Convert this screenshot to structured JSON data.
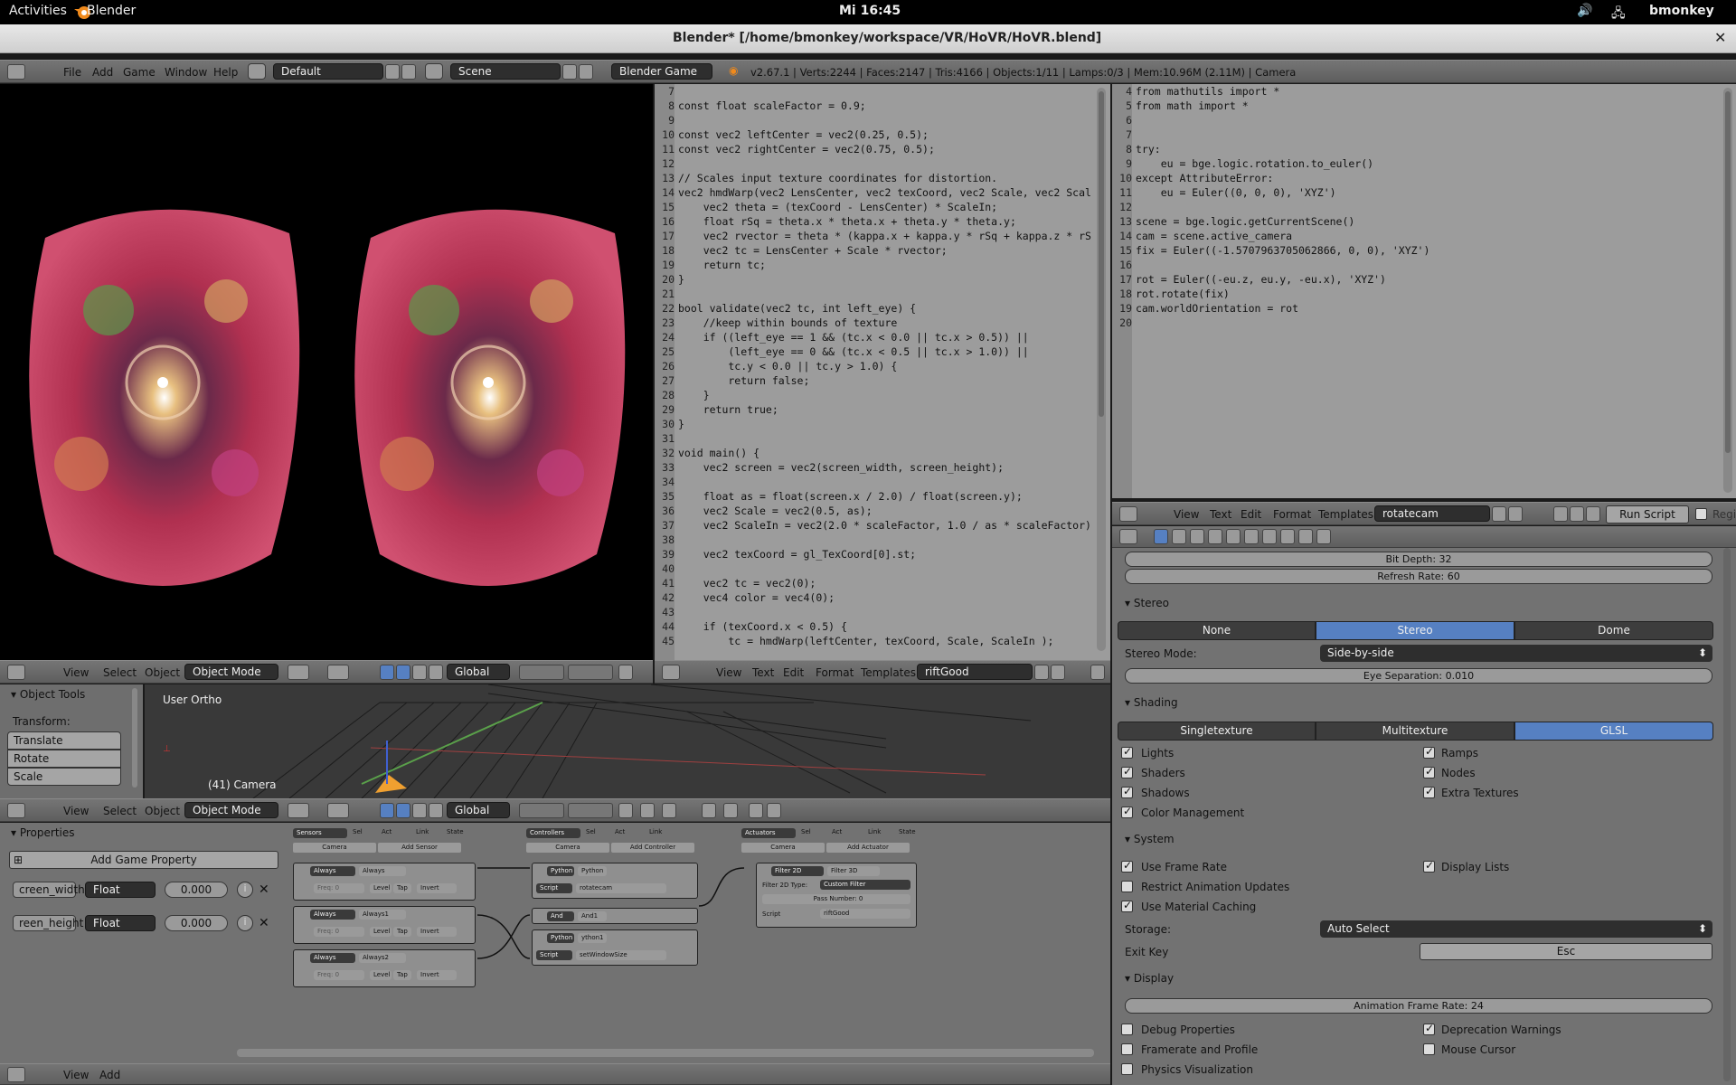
{
  "topbar": {
    "activities": "Activities",
    "app": "Blender",
    "clock": "Mi 16:45",
    "user": "bmonkey"
  },
  "window": {
    "title": "Blender* [/home/bmonkey/workspace/VR/HoVR/HoVR.blend]"
  },
  "info_header": {
    "menus": [
      "File",
      "Add",
      "Game",
      "Window",
      "Help"
    ],
    "layout": "Default",
    "scene": "Scene",
    "engine": "Blender Game",
    "stats": "v2.67.1 | Verts:2244 | Faces:2147 | Tris:4166 | Objects:1/11 | Lamps:0/3 | Mem:10.96M (2.11M) | Camera"
  },
  "glsl_editor": {
    "line_numbers": [
      "7",
      "8",
      "9",
      "10",
      "11",
      "12",
      "13",
      "14",
      "15",
      "16",
      "17",
      "18",
      "19",
      "20",
      "21",
      "22",
      "23",
      "24",
      "25",
      "26",
      "27",
      "28",
      "29",
      "30",
      "31",
      "32",
      "33",
      "34",
      "35",
      "36",
      "37",
      "38",
      "39",
      "40",
      "41",
      "42",
      "43",
      "44",
      "45"
    ],
    "lines": [
      "",
      "const float scaleFactor = 0.9;",
      "",
      "const vec2 leftCenter = vec2(0.25, 0.5);",
      "const vec2 rightCenter = vec2(0.75, 0.5);",
      "",
      "// Scales input texture coordinates for distortion.",
      "vec2 hmdWarp(vec2 LensCenter, vec2 texCoord, vec2 Scale, vec2 Scal",
      "    vec2 theta = (texCoord - LensCenter) * ScaleIn;",
      "    float rSq = theta.x * theta.x + theta.y * theta.y;",
      "    vec2 rvector = theta * (kappa.x + kappa.y * rSq + kappa.z * rS",
      "    vec2 tc = LensCenter + Scale * rvector;",
      "    return tc;",
      "}",
      "",
      "bool validate(vec2 tc, int left_eye) {",
      "    //keep within bounds of texture",
      "    if ((left_eye == 1 && (tc.x < 0.0 || tc.x > 0.5)) ||",
      "        (left_eye == 0 && (tc.x < 0.5 || tc.x > 1.0)) ||",
      "        tc.y < 0.0 || tc.y > 1.0) {",
      "        return false;",
      "    }",
      "    return true;",
      "}",
      "",
      "void main() {",
      "    vec2 screen = vec2(screen_width, screen_height);",
      "",
      "    float as = float(screen.x / 2.0) / float(screen.y);",
      "    vec2 Scale = vec2(0.5, as);",
      "    vec2 ScaleIn = vec2(2.0 * scaleFactor, 1.0 / as * scaleFactor)",
      "",
      "    vec2 texCoord = gl_TexCoord[0].st;",
      "",
      "    vec2 tc = vec2(0);",
      "    vec4 color = vec4(0);",
      "",
      "    if (texCoord.x < 0.5) {",
      "        tc = hmdWarp(leftCenter, texCoord, Scale, ScaleIn );"
    ],
    "menus": [
      "View",
      "Text",
      "Edit",
      "Format",
      "Templates"
    ],
    "file": "riftGood"
  },
  "py_editor": {
    "line_numbers": [
      "4",
      "5",
      "6",
      "7",
      "8",
      "9",
      "10",
      "11",
      "12",
      "13",
      "14",
      "15",
      "16",
      "17",
      "18",
      "19",
      "20"
    ],
    "lines": [
      "from mathutils import *",
      "from math import *",
      "",
      "",
      "try:",
      "    eu = bge.logic.rotation.to_euler()",
      "except AttributeError:",
      "    eu = Euler((0, 0, 0), 'XYZ')",
      "",
      "scene = bge.logic.getCurrentScene()",
      "cam = scene.active_camera",
      "fix = Euler((-1.5707963705062866, 0, 0), 'XYZ')",
      "",
      "rot = Euler((-eu.z, eu.y, -eu.x), 'XYZ')",
      "rot.rotate(fix)",
      "cam.worldOrientation = rot",
      ""
    ],
    "menus": [
      "View",
      "Text",
      "Edit",
      "Format",
      "Templates"
    ],
    "file": "rotatecam",
    "run": "Run Script",
    "register": "Regist"
  },
  "view3d_header": {
    "menus": [
      "View",
      "Select",
      "Object"
    ],
    "mode": "Object Mode",
    "orientation": "Global"
  },
  "tools": {
    "title": "Object Tools",
    "transform": "Transform:",
    "buttons": [
      "Translate",
      "Rotate",
      "Scale"
    ]
  },
  "viewport": {
    "label": "User Ortho",
    "object": "(41) Camera"
  },
  "logic_header": {
    "menus": [
      "View",
      "Select",
      "Object"
    ],
    "mode": "Object Mode",
    "orientation": "Global"
  },
  "properties": {
    "title": "Properties",
    "add": "Add Game Property",
    "items": [
      {
        "name": "creen_width",
        "type": "Float",
        "value": "0.000"
      },
      {
        "name": "reen_height",
        "type": "Float",
        "value": "0.000"
      }
    ]
  },
  "logic": {
    "sensors": "Sensors",
    "controllers": "Controllers",
    "actuators": "Actuators",
    "sel": "Sel",
    "act": "Act",
    "link": "Link",
    "state": "State",
    "camera": "Camera",
    "add_sensor": "Add Sensor",
    "add_controller": "Add Controller",
    "add_actuator": "Add Actuator",
    "sensor_nodes": [
      {
        "type": "Always",
        "name": "Always"
      },
      {
        "type": "Always",
        "name": "Always1"
      },
      {
        "type": "Always",
        "name": "Always2"
      }
    ],
    "freq": "Freq: 0",
    "level": "Level",
    "tap": "Tap",
    "invert": "Invert",
    "controller_nodes": [
      {
        "type": "Python",
        "name": "Python",
        "script": "rotatecam"
      },
      {
        "type": "And",
        "name": "And1"
      },
      {
        "type": "Python",
        "name": "ython1",
        "script": "setWindowSize"
      }
    ],
    "script": "Script",
    "actuator": {
      "type": "Filter 2D",
      "name": "Filter 3D",
      "ftype_label": "Filter 2D Type:",
      "ftype": "Custom Filter",
      "pass": "Pass Number: 0",
      "script": "riftGood"
    }
  },
  "render_props": {
    "bit_depth": "Bit Depth: 32",
    "refresh": "Refresh Rate: 60",
    "stereo_title": "Stereo",
    "stereo_opts": [
      "None",
      "Stereo",
      "Dome"
    ],
    "stereo_mode_label": "Stereo Mode:",
    "stereo_mode": "Side-by-side",
    "eye_sep": "Eye Separation: 0.010",
    "shading_title": "Shading",
    "shading_opts": [
      "Singletexture",
      "Multitexture",
      "GLSL"
    ],
    "shading_checks": [
      {
        "label": "Lights",
        "on": true
      },
      {
        "label": "Ramps",
        "on": true
      },
      {
        "label": "Shaders",
        "on": true
      },
      {
        "label": "Nodes",
        "on": true
      },
      {
        "label": "Shadows",
        "on": true
      },
      {
        "label": "Extra Textures",
        "on": true
      },
      {
        "label": "Color Management",
        "on": true
      }
    ],
    "system_title": "System",
    "system_checks": [
      {
        "label": "Use Frame Rate",
        "on": true
      },
      {
        "label": "Display Lists",
        "on": true
      },
      {
        "label": "Restrict Animation Updates",
        "on": false
      },
      {
        "label": "Use Material Caching",
        "on": true
      }
    ],
    "storage_label": "Storage:",
    "storage": "Auto Select",
    "exit_label": "Exit Key",
    "exit": "Esc",
    "display_title": "Display",
    "anim_rate": "Animation Frame Rate: 24",
    "display_checks": [
      {
        "label": "Debug Properties",
        "on": false
      },
      {
        "label": "Deprecation Warnings",
        "on": true
      },
      {
        "label": "Framerate and Profile",
        "on": false
      },
      {
        "label": "Mouse Cursor",
        "on": false
      },
      {
        "label": "Physics Visualization",
        "on": false
      }
    ]
  },
  "bottom_header": {
    "menus": [
      "View",
      "Add"
    ]
  }
}
